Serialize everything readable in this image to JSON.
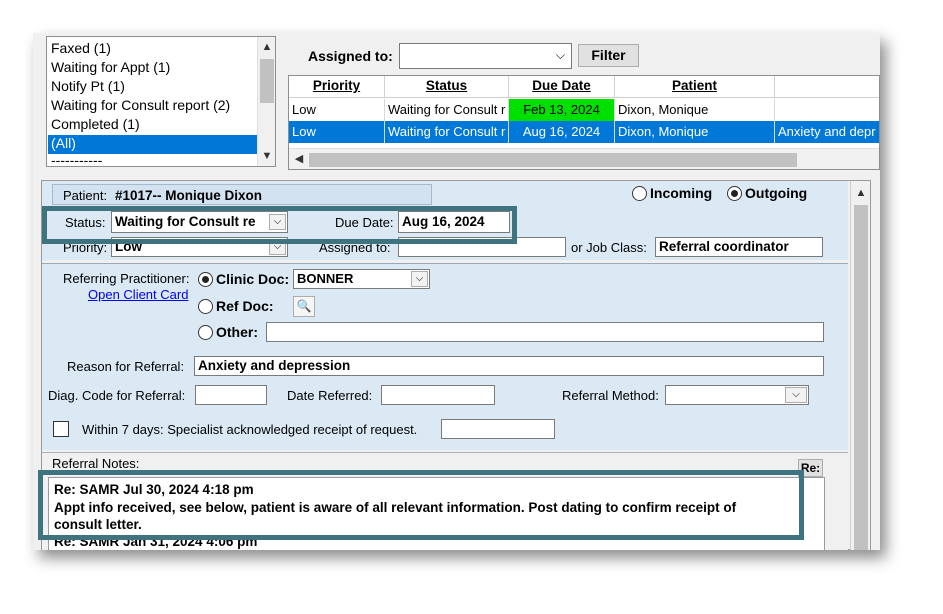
{
  "status_list": {
    "items": [
      "Faxed (1)",
      "Waiting for Appt (1)",
      "Notify Pt (1)",
      "Waiting for Consult report (2)",
      "Completed (1)",
      "(All)",
      "-----------"
    ],
    "selected": "(All)"
  },
  "assigned_to": {
    "label": "Assigned to:",
    "value": ""
  },
  "filter_button": "Filter",
  "grid": {
    "columns": [
      "Priority",
      "Status",
      "Due Date",
      "Patient"
    ],
    "rows": [
      {
        "priority": "Low",
        "status": "Waiting for Consult r",
        "due": "Feb 13, 2024",
        "patient": "Dixon, Monique",
        "extra": "",
        "due_color": "#00e000"
      },
      {
        "priority": "Low",
        "status": "Waiting for Consult r",
        "due": "Aug 16, 2024",
        "patient": "Dixon, Monique",
        "extra": "Anxiety and depr",
        "selected": true
      }
    ]
  },
  "detail": {
    "patient_label": "Patient:",
    "patient_value": "#1017-- Monique Dixon",
    "incoming_label": "Incoming",
    "outgoing_label": "Outgoing",
    "direction": "Outgoing",
    "status_label": "Status:",
    "status_value": "Waiting for Consult re",
    "due_date_label": "Due Date:",
    "due_date_value": "Aug 16, 2024",
    "priority_label": "Priority:",
    "priority_value": "Low",
    "assigned_label": "Assigned to:",
    "assigned_value": "",
    "job_class_label": "or Job Class:",
    "job_class_value": "Referral coordinator",
    "ref_practitioner_label": "Referring Practitioner:",
    "open_client_card": "Open Client Card",
    "clinic_doc_label": "Clinic Doc:",
    "clinic_doc_value": "BONNER",
    "ref_doc_label": "Ref Doc:",
    "other_label": "Other:",
    "reason_label": "Reason for Referral:",
    "reason_value": "Anxiety and depression",
    "diag_label": "Diag. Code for Referral:",
    "date_referred_label": "Date Referred:",
    "referral_method_label": "Referral Method:",
    "within7_label": "Within 7 days: Specialist acknowledged receipt of request.",
    "referral_notes_label": "Referral Notes:",
    "re_button": "Re:",
    "notes": [
      "Re: SAMR Jul 30, 2024  4:18 pm",
      "Appt info received, see below, patient is aware of all relevant information. Post dating to confirm receipt of",
      "consult letter.",
      "Re: SAMR Jan 31, 2024  4:06 pm"
    ]
  },
  "colors": {
    "selection": "#0078d7",
    "panel_blue": "#dbe9f5",
    "highlight_box": "#3d7480",
    "due_green": "#00e000"
  }
}
